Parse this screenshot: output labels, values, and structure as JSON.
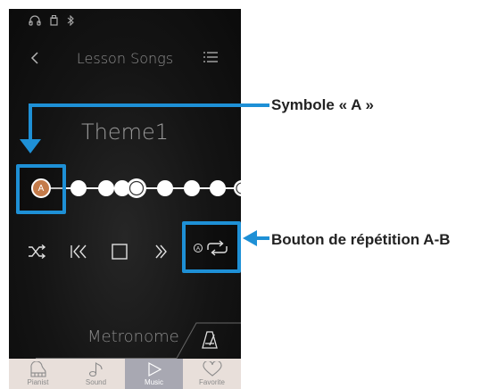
{
  "screen": {
    "nav": {
      "title": "Lesson Songs"
    },
    "song_title": "Theme1",
    "marker_a_label": "A",
    "metronome_label": "Metronome",
    "tabs": [
      {
        "label": "Pianist",
        "icon": "piano-icon",
        "active": false
      },
      {
        "label": "Sound",
        "icon": "music-note-icon",
        "active": false
      },
      {
        "label": "Music",
        "icon": "play-icon",
        "active": true
      },
      {
        "label": "Favorite",
        "icon": "heart-icon",
        "active": false
      }
    ],
    "controls": [
      "shuffle-icon",
      "previous-icon",
      "stop-icon",
      "next-icon",
      "ab-repeat-icon"
    ]
  },
  "annotations": {
    "symbol_a": "Symbole « A »",
    "ab_repeat": "Bouton de répétition A-B"
  },
  "colors": {
    "accent": "#1e90d6",
    "marker": "#c47b4a",
    "tab_active": "#a8a8b2",
    "tab_bar": "#e8dfda"
  }
}
